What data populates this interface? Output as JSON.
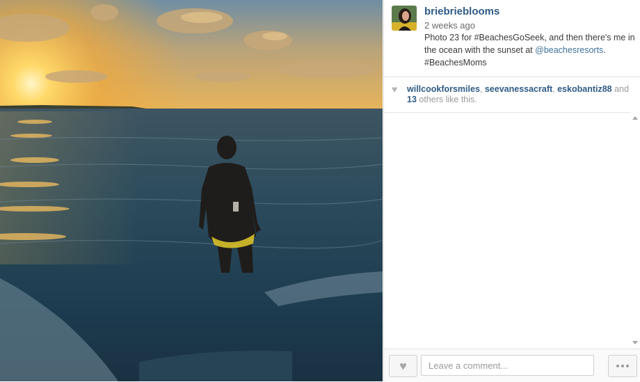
{
  "post": {
    "username": "briebrieblooms",
    "time_ago": "2 weeks ago",
    "caption_before": "Photo 23 for #BeachesGoSeek, and then there's me in the ocean with the sunset at ",
    "caption_mention": "@beachesresorts",
    "caption_after": ". #BeachesMoms"
  },
  "likes": {
    "users": [
      "willcookforsmiles",
      "seevanessacraft",
      "eskobantiz88"
    ],
    "separator": ", ",
    "and_text": " and ",
    "others_count": "13",
    "others_suffix": " others like this."
  },
  "footer": {
    "comment_placeholder": "Leave a comment..."
  },
  "icons": {
    "like": "heart-icon",
    "more": "ellipsis-icon",
    "scroll_up": "arrow-up-icon",
    "scroll_down": "arrow-down-icon"
  }
}
